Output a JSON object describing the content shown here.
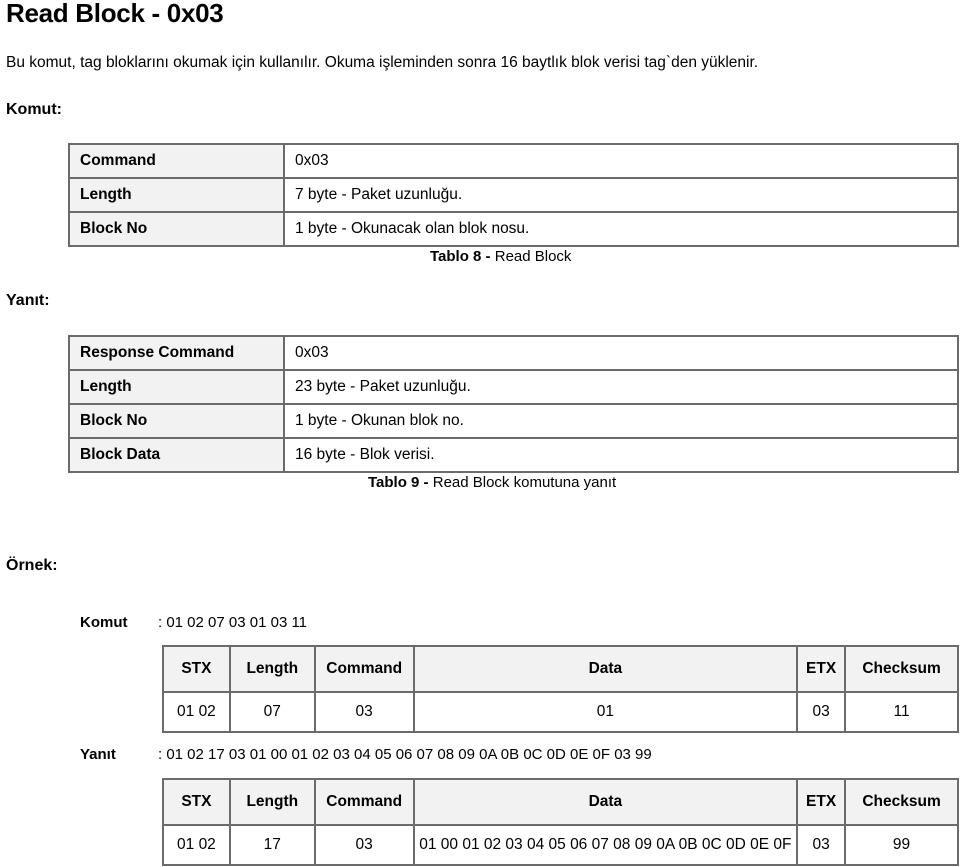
{
  "title": "Read Block - 0x03",
  "intro": "Bu komut, tag bloklarını okumak için kullanılır. Okuma işleminden sonra 16 baytlık blok verisi tag`den yüklenir.",
  "command_section": {
    "heading": "Komut:",
    "rows": [
      {
        "label": "Command",
        "value": "0x03"
      },
      {
        "label": "Length",
        "value": "7 byte - Paket uzunluğu."
      },
      {
        "label": "Block No",
        "value": "1 byte - Okunacak olan blok nosu."
      }
    ],
    "caption_bold": "Tablo 8 -",
    "caption_text": " Read Block"
  },
  "response_section": {
    "heading": "Yanıt:",
    "rows": [
      {
        "label": "Response Command",
        "value": "0x03"
      },
      {
        "label": "Length",
        "value": "23 byte - Paket uzunluğu."
      },
      {
        "label": "Block No",
        "value": "1 byte - Okunan blok no."
      },
      {
        "label": "Block Data",
        "value": "16 byte - Blok verisi."
      }
    ],
    "caption_bold": "Tablo 9 -",
    "caption_text": " Read Block komutuna yanıt"
  },
  "example_section": {
    "heading": "Örnek:",
    "frame_headers": [
      "STX",
      "Length",
      "Command",
      "Data",
      "ETX",
      "Checksum"
    ],
    "command_example": {
      "label": "Komut",
      "bytes": ": 01 02 07 03 01 03 11",
      "values": [
        "01 02",
        "07",
        "03",
        "01",
        "03",
        "11"
      ]
    },
    "response_example": {
      "label": "Yanıt",
      "bytes": ": 01 02 17 03 01 00 01 02 03 04 05 06 07 08 09 0A 0B 0C 0D 0E 0F 03 99",
      "values": [
        "01 02",
        "17",
        "03",
        "01 00 01 02 03 04 05 06 07 08 09 0A 0B 0C 0D 0E 0F",
        "03",
        "99"
      ]
    }
  }
}
